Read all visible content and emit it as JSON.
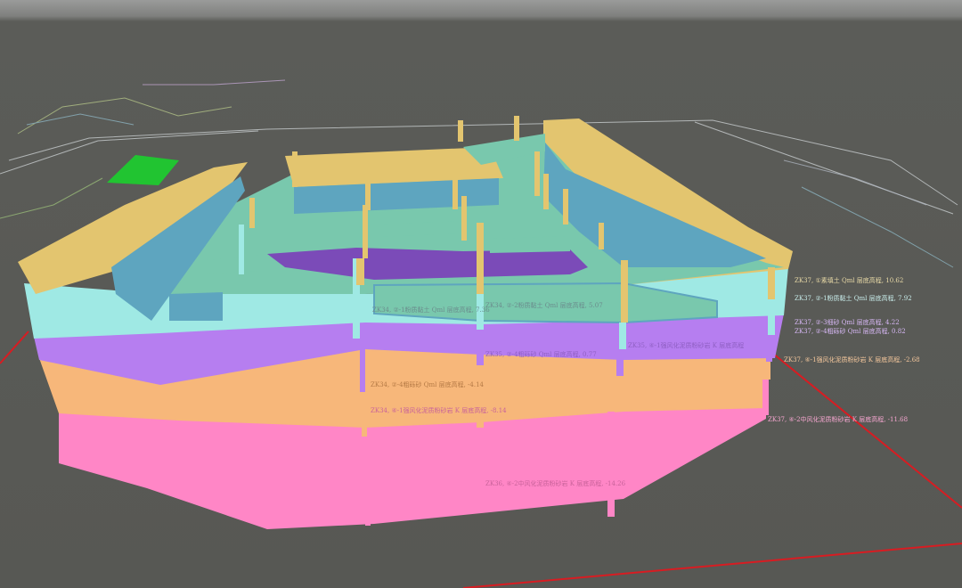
{
  "viewport": {
    "background_top": "#9a9b9a",
    "background": "#575854",
    "colors": {
      "fill_soil": "#e3c56f",
      "silty_clay": "#9fe9e4",
      "fine_sand": "#b67ef0",
      "medium_sand": "#f7b77a",
      "weathered_rock": "#ff86c6",
      "top_surface": "#79c8ad",
      "excavation": "#5ea5bf",
      "bottom_pit": "#7b4bb8",
      "marker": "#21c431",
      "grid_line": "#cfd4d6",
      "boundary_line": "#d81c22"
    }
  },
  "borehole_labels": [
    "ZK37, ①素填土 Qml 层底高程, 10.62",
    "ZK37, ②-1粉质黏土 Qml 层底高程, 7.92",
    "ZK37, ②-3细砂 Qml 层底高程, 4.22",
    "ZK37, ②-4粗砾砂 Qml 层底高程, 0.82",
    "ZK37, ④-1强风化泥质粉砂岩 K 层底高程, -2.68",
    "ZK37, ④-2中风化泥质粉砂岩 K 层底高程, -11.68"
  ],
  "front_labels": [
    "ZK34, ②-1粉质黏土 Qml 层底高程, 7.36",
    "ZK34, ②-2粉质黏土 Qml 层底高程, 5.07",
    "ZK34, ②-4粗砾砂 Qml 层底高程, -4.14",
    "ZK34, ④-1强风化泥质粉砂岩 K 层底高程, -8.14",
    "ZK35, ②-4粗砾砂 Qml 层底高程, 0.77",
    "ZK35, ④-1强风化泥质粉砂岩 K 层底高程",
    "ZK36, ④-2中风化泥质粉砂岩 K 层底高程, -14.26"
  ]
}
